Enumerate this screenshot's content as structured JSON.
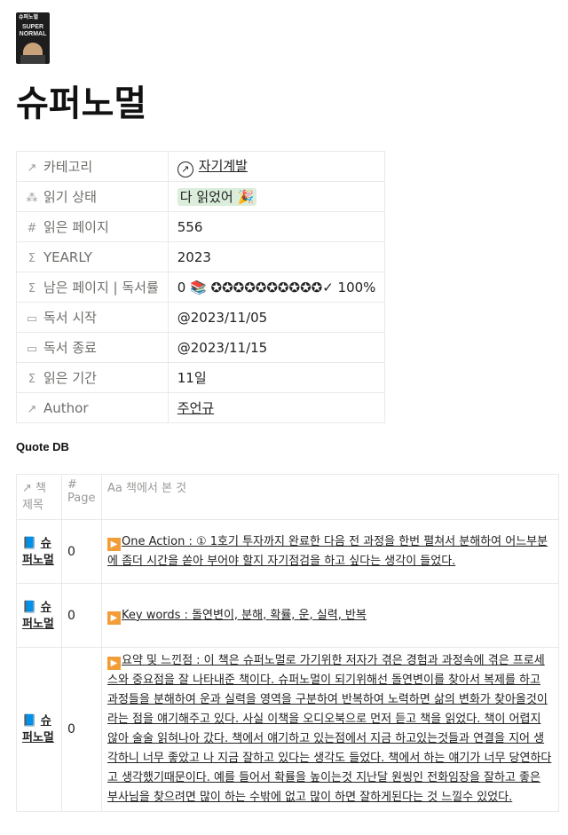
{
  "page": {
    "cover": {
      "top_text": "슈퍼노멀",
      "title_text": "SUPER NORMAL"
    },
    "title": "슈퍼노멀"
  },
  "properties": [
    {
      "icon": "↗",
      "key": "카테고리",
      "value": "자기계발"
    },
    {
      "icon": "⁂",
      "key": "읽기 상태",
      "value": "다 읽었어 🎉"
    },
    {
      "icon": "#",
      "key": "읽은 페이지",
      "value": "556"
    },
    {
      "icon": "Σ",
      "key": "YEARLY",
      "value": "2023"
    },
    {
      "icon": "Σ",
      "key": "남은 페이지 | 독서률",
      "value": "0 📚 ✪✪✪✪✪✪✪✪✪✪✓ 100%"
    },
    {
      "icon": "▭",
      "key": "독서 시작",
      "value": "@2023/11/05"
    },
    {
      "icon": "▭",
      "key": "독서 종료",
      "value": "@2023/11/15"
    },
    {
      "icon": "Σ",
      "key": "읽은 기간",
      "value": "11일"
    },
    {
      "icon": "↗",
      "key": "Author",
      "value": "주언규"
    }
  ],
  "quote_db": {
    "title": "Quote DB",
    "headers": {
      "book": "↗ 책 제목",
      "page": "# Page",
      "note": "Aa 책에서 본 것"
    },
    "rows": [
      {
        "book": "슈퍼노멀",
        "page": "0",
        "note": "One Action : ① 1호기 투자까지 완료한 다음 전 과정을 한번 펼쳐서 분해하여 어느부분에 좀더 시간을 쏟아 부어야 할지 자기점검을 하고 싶다는 생각이 들었다."
      },
      {
        "book": "슈퍼노멀",
        "page": "0",
        "note": "Key words : 돌연변이, 분해, 확률, 운, 실력, 반복"
      },
      {
        "book": "슈퍼노멀",
        "page": "0",
        "note": "요약 및 느낀점 : 이 책은 슈퍼노멀로 가기위한 저자가 겪은 경험과 과정속에 겪은 프로세스와 중요점을 잘 나타내준 책이다. 슈퍼노멀이 되기위해선 돌연변이를 찾아서 복제를 하고 과정들을 분해하여 운과 실력을 영역을 구분하여 반복하여 노력하면 삶의 변화가 찾아올것이라는 점을 얘기해주고 있다. 사실 이책을 오디오북으로 먼저 듣고 책을 읽었다. 책이 어렵지 않아 술술 읽혀나아 갔다. 책에서 얘기하고 있는점에서 지금 하고있는것들과 연결을 지어 생각하니 너무 좋았고 나 지금 잘하고 있다는 생각도 들었다. 책에서 하는 얘기가 너무 당연하다고 생각했기때문이다. 예를 들어서 확률을 높이는것 지난달 원씽인 전화임장을 잘하고 좋은 부사님을 찾으려면 많이 하는 수밖에 없고 많이 하면 잘하게된다는 것 느낄수 있었다."
      }
    ]
  }
}
